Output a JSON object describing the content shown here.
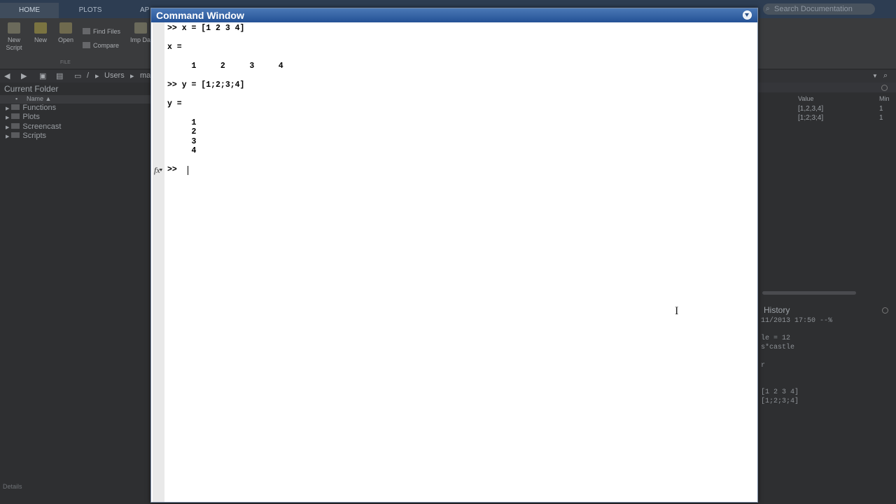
{
  "tabs": [
    {
      "label": "HOME",
      "active": true
    },
    {
      "label": "PLOTS",
      "active": false
    },
    {
      "label": "AP",
      "active": false
    }
  ],
  "search": {
    "placeholder": "Search Documentation"
  },
  "ribbon": {
    "buttons": [
      {
        "label": "New Script"
      },
      {
        "label": "New"
      },
      {
        "label": "Open"
      },
      {
        "label": "Imp Da"
      }
    ],
    "small": [
      {
        "label": "Find Files"
      },
      {
        "label": "Compare"
      }
    ],
    "group_label": "FILE"
  },
  "path": {
    "segments": [
      "/",
      "Users",
      "ma"
    ]
  },
  "current_folder": {
    "title": "Current Folder",
    "column": "Name ▲",
    "items": [
      "Functions",
      "Plots",
      "Screencast",
      "Scripts"
    ],
    "details": "Details"
  },
  "workspace": {
    "columns": {
      "value": "Value",
      "min": "Min"
    },
    "rows": [
      {
        "value": "[1,2,3,4]",
        "min": "1"
      },
      {
        "value": "[1;2;3;4]",
        "min": "1"
      }
    ]
  },
  "history": {
    "title": "History",
    "lines": [
      "11/2013 17:50 --%",
      "le = 12",
      "s*castle",
      "r",
      "[1 2 3 4]",
      "[1;2;3;4]"
    ]
  },
  "command_window": {
    "title": "Command Window",
    "lines": [
      ">> x = [1 2 3 4]",
      "x =",
      "     1     2     3     4",
      ">> y = [1;2;3;4]",
      "y =",
      "     1",
      "     2",
      "     3",
      "     4"
    ],
    "prompt": ">>",
    "fx_label": "fx"
  },
  "colors": {
    "title_bar": "#245195",
    "window_bg": "#ffffff",
    "desktop_bg": "#2b2c2e"
  }
}
